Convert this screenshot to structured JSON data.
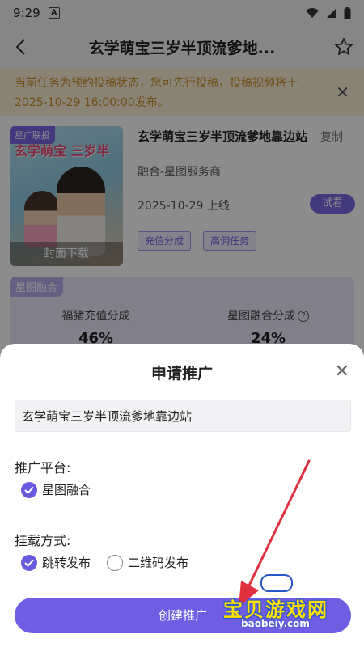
{
  "status": {
    "time": "9:29",
    "notif": "A"
  },
  "nav": {
    "title": "玄学萌宝三岁半顶流爹地..."
  },
  "notice": {
    "text": "当前任务为预约投稿状态，您可先行投稿，投稿视频将于2025-10-29 16:00:00发布。"
  },
  "drama": {
    "cover_tag": "星广联投",
    "cover_art_text": "玄学萌宝 三岁半",
    "cover_download": "封面下载",
    "title": "玄学萌宝三岁半顶流爹地靠边站",
    "copy_label": "复制",
    "provider": "融合-星图服务商",
    "release": "2025-10-29 上线",
    "watch_label": "试看",
    "chips": [
      "充值分成",
      "高佣任务"
    ]
  },
  "fusion": {
    "tag": "星图融合",
    "col1_label": "福猪充值分成",
    "col1_value": "46%",
    "col2_label": "星图融合分成",
    "col2_value": "24%"
  },
  "sheet": {
    "title": "申请推广",
    "name_value": "玄学萌宝三岁半顶流爹地靠边站",
    "platform_label": "推广平台:",
    "platform_option": "星图融合",
    "platform_checked": true,
    "mount_label": "挂载方式:",
    "mount_options": [
      {
        "label": "跳转发布",
        "checked": true
      },
      {
        "label": "二维码发布",
        "checked": false
      }
    ],
    "create_label": "创建推广"
  },
  "watermark": {
    "text": "宝贝游戏网",
    "url": "baobeiy.com"
  },
  "colors": {
    "accent": "#6f5ee4",
    "notice_text": "#c8902a",
    "notice_bg": "#faf0d8",
    "annotation_arrow": "#e03040"
  }
}
